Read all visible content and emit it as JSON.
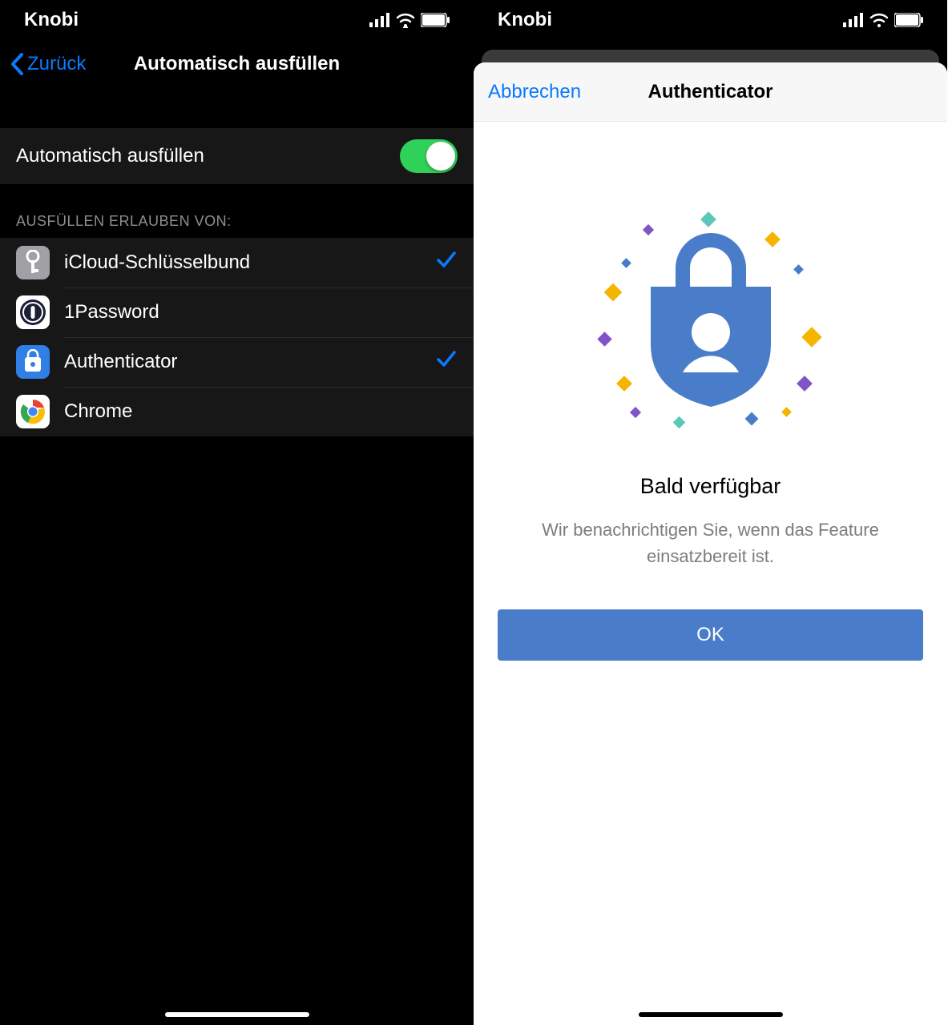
{
  "left": {
    "status_carrier": "Knobi",
    "nav": {
      "back": "Zurück",
      "title": "Automatisch ausfüllen"
    },
    "toggle": {
      "label": "Automatisch ausfüllen",
      "on": true
    },
    "section_header": "AUSFÜLLEN ERLAUBEN VON:",
    "providers": [
      {
        "label": "iCloud-Schlüsselbund",
        "checked": true
      },
      {
        "label": "1Password",
        "checked": false
      },
      {
        "label": "Authenticator",
        "checked": true
      },
      {
        "label": "Chrome",
        "checked": false
      }
    ]
  },
  "right": {
    "status_carrier": "Knobi",
    "modal": {
      "cancel": "Abbrechen",
      "title": "Authenticator",
      "headline": "Bald verfügbar",
      "subtitle": "Wir benachrichtigen Sie, wenn das Feature einsatzbereit ist.",
      "ok": "OK"
    }
  }
}
